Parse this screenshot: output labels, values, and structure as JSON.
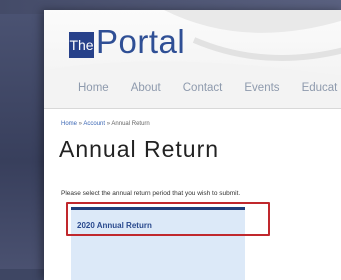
{
  "logo": {
    "badge_text": "The",
    "word_text": "Portal"
  },
  "nav": {
    "items": [
      "Home",
      "About",
      "Contact",
      "Events",
      "Educat"
    ]
  },
  "breadcrumb": {
    "home": "Home",
    "sep1": " » ",
    "account": "Account",
    "sep2": " » ",
    "current": "Annual Return"
  },
  "page": {
    "title": "Annual Return",
    "instruction": "Please select the annual return period that you wish to submit."
  },
  "returns": {
    "items": [
      {
        "label": "2020 Annual Return"
      }
    ]
  },
  "colors": {
    "brand_blue": "#27418a",
    "highlight_red": "#c0282d",
    "panel_blue": "#dce9f8"
  }
}
